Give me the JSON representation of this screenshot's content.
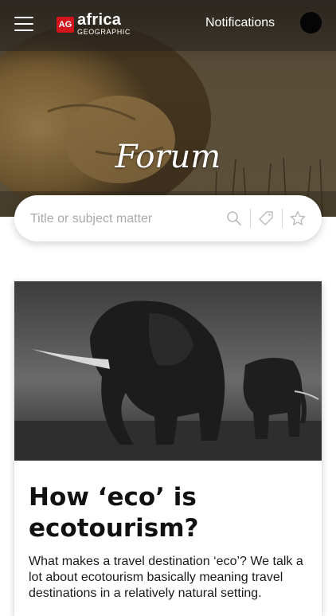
{
  "header": {
    "logo_badge": "AG",
    "logo_word": "africa",
    "logo_sub": "GEOGRAPHIC",
    "notifications_label": "Notifications"
  },
  "hero": {
    "title": "Forum"
  },
  "search": {
    "placeholder": "Title or subject matter"
  },
  "article": {
    "title": "How ‘eco’ is ecotourism?",
    "excerpt": "What makes a travel destination ‘eco’? We talk a lot about ecotourism basically meaning travel destinations in a relatively natural setting."
  },
  "colors": {
    "brand_red": "#d4141c",
    "topbar_bg": "#2c2824"
  },
  "icons": [
    "menu-icon",
    "search-icon",
    "tag-icon",
    "star-icon"
  ]
}
